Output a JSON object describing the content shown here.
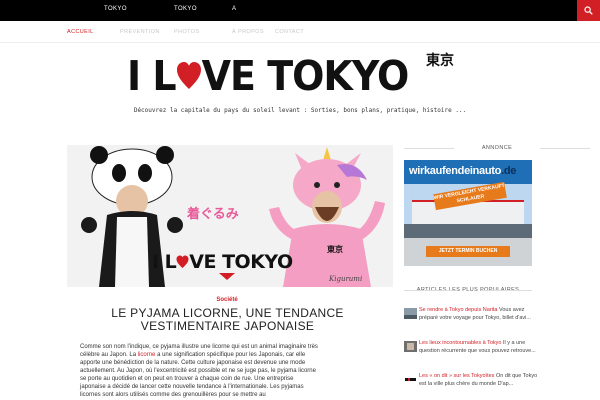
{
  "topbar": {
    "links": [
      "TOKYO",
      "TOKYO",
      "A"
    ]
  },
  "nav": {
    "items": [
      "ACCUEIL",
      "PRÉVENTION",
      "PHOTOS",
      "À PROPOS",
      "CONTACT"
    ],
    "active": "ACCUEIL"
  },
  "logo": {
    "text_left": "I L",
    "text_right": "VE TOKYO",
    "kanji": "東京",
    "tagline": "Découvrez la capitale du pays du soleil levant : Sorties, bons plans, pratique, histoire ..."
  },
  "article": {
    "hero": {
      "kanji": "着ぐるみ",
      "logo_left": "I L",
      "logo_right": "VE TOKYO",
      "logo_kanji": "東京",
      "signature": "Kigurumi"
    },
    "category": "Société",
    "title": "LE PYJAMA LICORNE, UNE TENDANCE VESTIMENTAIRE JAPONAISE",
    "body_before_link": "Comme son nom l'indique, ce pyjama illustre une licorne qui est un animal imaginaire très célèbre au Japon. La",
    "body_link": "licorne",
    "body_after_link": "a une signification spécifique pour les Japonais, car elle apporte une bénédiction de la nature. Cette culture japonaise est devenue une mode actuellement. Au Japon, où l'excentricité est possible et ne se juge pas, le pyjama licorne se porte au quotidien et on peut en trouver à chaque coin de rue. Une entreprise japonaise a décidé de lancer cette nouvelle tendance à l'internationale. Les pyjamas licornes sont alors utilisés comme des grenouillères pour se mettre au"
  },
  "sidebar": {
    "ad_title": "ANNONCE",
    "ad": {
      "brand_a": "wirkaufendeinauto",
      "brand_b": ".de",
      "tag": "WIR VERGLEICHT VERKAUFT SCHLAUER",
      "cta": "JETZT TERMIN BUCHEN"
    },
    "popular_title": "ARTICLES LES PLUS POPULAIRES",
    "posts": [
      {
        "link": "Se rendre à Tokyo depuis Narita",
        "text": " Vous avez préparé votre voyage pour Tokyo, billet d'avi..."
      },
      {
        "link": "Les lieux incontournables à Tokyo",
        "text": " Il y a une question récurrente que vous pouvez retrouve..."
      },
      {
        "link": "Les « on dit » sur les Tokyoïtes",
        "text": " On dit que Tokyo est la ville plus chère du monde D'ap..."
      }
    ]
  },
  "colors": {
    "accent": "#d11f25",
    "black": "#000000"
  }
}
